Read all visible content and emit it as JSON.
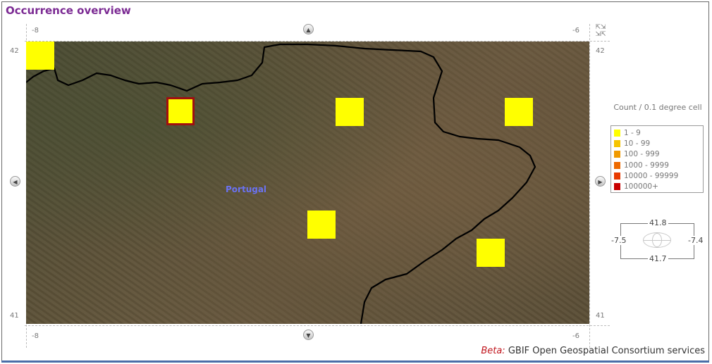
{
  "title": "Occurrence overview",
  "map": {
    "country_label": "Portugal",
    "x_ticks_top": [
      "-8",
      "-6"
    ],
    "x_ticks_bottom": [
      "-8",
      "-6"
    ],
    "y_ticks_left": [
      "42",
      "41"
    ],
    "y_ticks_right": [
      "42",
      "41"
    ],
    "cell_color": "#ffff00",
    "selected_border_color": "#a01010"
  },
  "legend": {
    "title": "Count / 0.1 degree cell",
    "items": [
      {
        "label": "1 - 9",
        "color": "#ffff00"
      },
      {
        "label": "10 - 99",
        "color": "#f5c400"
      },
      {
        "label": "100 - 999",
        "color": "#f09a00"
      },
      {
        "label": "1000 - 9999",
        "color": "#ee6a00"
      },
      {
        "label": "10000 - 99999",
        "color": "#e83a00"
      },
      {
        "label": "100000+",
        "color": "#c80000"
      }
    ]
  },
  "bbox": {
    "north": "41.8",
    "south": "41.7",
    "west": "-7.5",
    "east": "-7.4"
  },
  "footer": {
    "beta_label": "Beta:",
    "text": "GBIF Open Geospatial Consortium services"
  }
}
